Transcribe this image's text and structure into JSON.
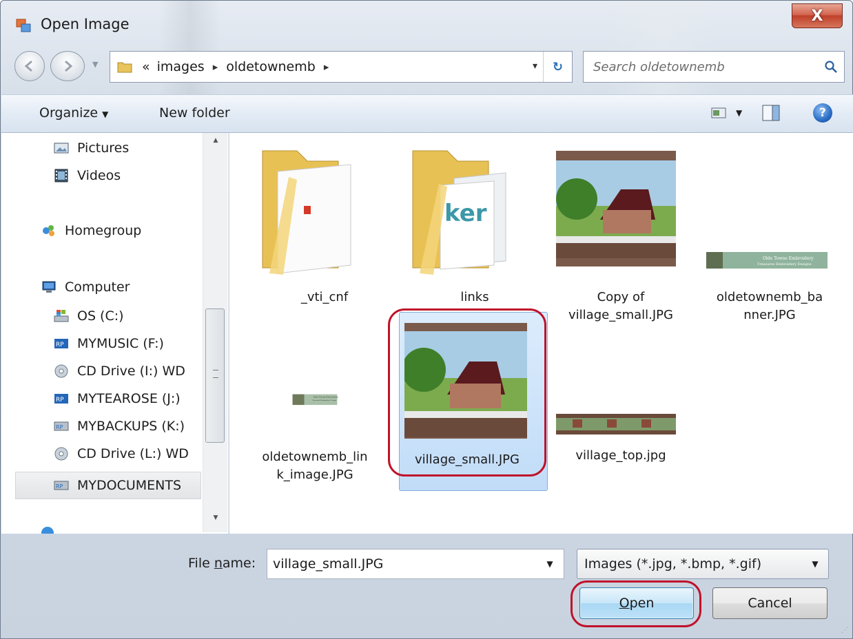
{
  "window": {
    "title": "Open Image",
    "close_glyph": "X"
  },
  "nav": {
    "back_icon": "back-arrow-icon",
    "forward_icon": "forward-arrow-icon"
  },
  "address": {
    "overflow": "«",
    "crumbs": [
      "images",
      "oldetownemb"
    ],
    "separator": "▸",
    "dropdown_glyph": "▾",
    "refresh_glyph": "↻"
  },
  "search": {
    "placeholder": "Search oldetownemb"
  },
  "toolbar": {
    "organize_label": "Organize",
    "new_folder_label": "New folder",
    "help_glyph": "?"
  },
  "sidebar": {
    "items": [
      {
        "label": "Pictures",
        "icon": "pictures-icon"
      },
      {
        "label": "Videos",
        "icon": "videos-icon"
      },
      {
        "label": "Homegroup",
        "icon": "homegroup-icon"
      },
      {
        "label": "Computer",
        "icon": "computer-icon"
      },
      {
        "label": "OS (C:)",
        "icon": "drive-os-icon"
      },
      {
        "label": "MYMUSIC (F:)",
        "icon": "removable-drive-icon"
      },
      {
        "label": "CD Drive (I:) WD",
        "icon": "cd-drive-icon"
      },
      {
        "label": "MYTEAROSE (J:)",
        "icon": "removable-drive-icon"
      },
      {
        "label": "MYBACKUPS (K:)",
        "icon": "network-drive-icon"
      },
      {
        "label": "CD Drive (L:) WD",
        "icon": "cd-drive-icon"
      },
      {
        "label": "MYDOCUMENTS",
        "icon": "network-drive-icon"
      }
    ],
    "selected": "MYDOCUMENTS"
  },
  "files": [
    {
      "name": "_vti_cnf",
      "type": "folder"
    },
    {
      "name": "links",
      "type": "folder"
    },
    {
      "name_line1": "Copy of",
      "name_line2": "village_small.JPG",
      "type": "image"
    },
    {
      "name_line1": "oldetownemb_ba",
      "name_line2": "nner.JPG",
      "type": "image"
    },
    {
      "name": "village_small.JPG",
      "type": "image",
      "selected": true
    },
    {
      "name_line1": "oldetownemb_lin",
      "name_line2": "k_image.JPG",
      "type": "image"
    },
    {
      "name": "village_top.jpg",
      "type": "image"
    }
  ],
  "thumb_text": {
    "banner_title": "Olde Towne Embroidery",
    "banner_sub": "Treasures Embroidery Designs",
    "link_title": "Olde Towne Embroidery",
    "link_sub": "Treasured Embroidery Designs"
  },
  "bottom": {
    "filename_label_pre": "File ",
    "filename_label_mnemonic": "n",
    "filename_label_post": "ame:",
    "filename_value": "village_small.JPG",
    "filetype_value": "Images (*.jpg, *.bmp, *.gif)",
    "dropdown_glyph": "▼",
    "open_mnemonic": "O",
    "open_rest": "pen",
    "cancel_label": "Cancel"
  },
  "colors": {
    "highlight_ring": "#c0122a",
    "selection": "#c1dcf8",
    "open_button": "#bde2f8"
  }
}
